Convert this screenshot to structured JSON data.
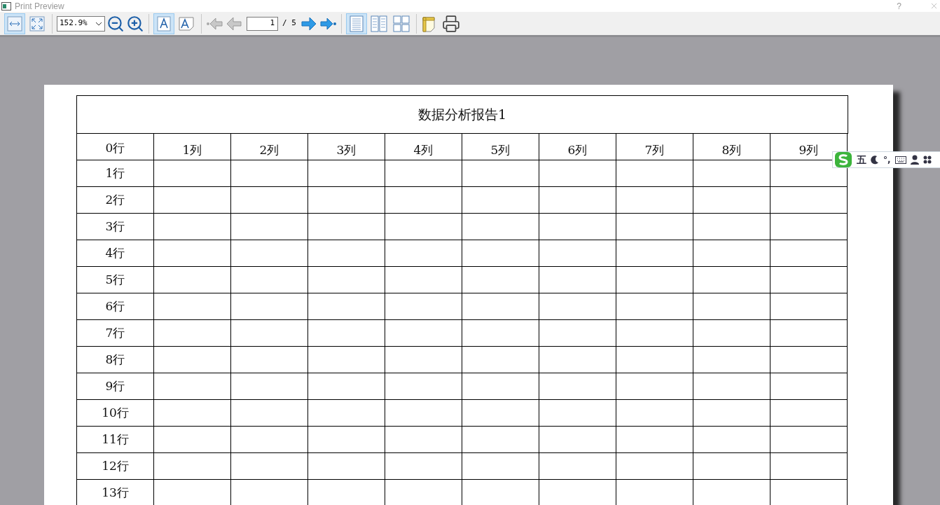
{
  "window": {
    "title": "Print Preview",
    "help": "?"
  },
  "toolbar": {
    "fit_buttons": [
      {
        "selected": true
      },
      {
        "selected": false
      }
    ],
    "zoom_value": "152.9%",
    "text_buttons": [
      {
        "selected": true
      },
      {
        "selected": false
      }
    ],
    "page_value": "1",
    "page_total": "/ 5",
    "layout_buttons": [
      {
        "selected": true
      },
      {
        "selected": false
      },
      {
        "selected": false
      }
    ]
  },
  "report": {
    "title": "数据分析报告1",
    "corner": "0行",
    "columns": [
      "1列",
      "2列",
      "3列",
      "4列",
      "5列",
      "6列",
      "7列",
      "8列",
      "9列"
    ],
    "rows": [
      "1行",
      "2行",
      "3行",
      "4行",
      "5行",
      "6行",
      "7行",
      "8行",
      "9行",
      "10行",
      "11行",
      "12行",
      "13行"
    ]
  },
  "ime_bar": {
    "mode": "五",
    "punct": "°,"
  }
}
